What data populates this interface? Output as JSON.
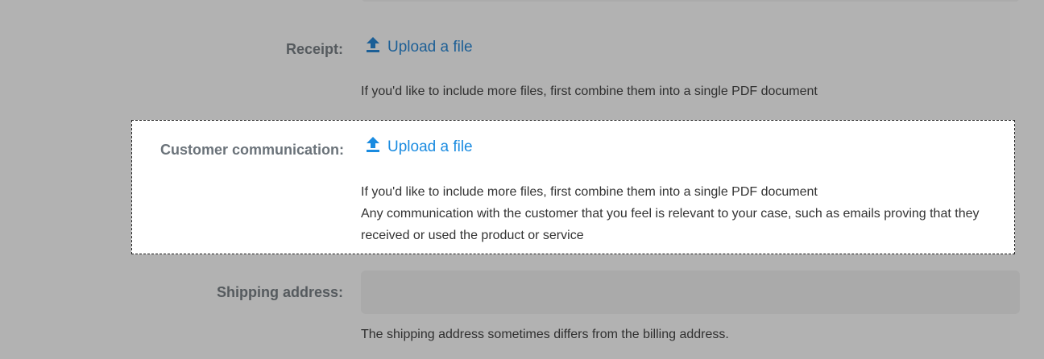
{
  "receipt": {
    "label": "Receipt:",
    "upload_label": "Upload a file",
    "upload_icon": "upload-icon",
    "help_text": "If you'd like to include more files, first combine them into a single PDF document"
  },
  "customer_communication": {
    "label": "Customer communication:",
    "upload_label": "Upload a file",
    "upload_icon": "upload-icon",
    "help_text_1": "If you'd like to include more files, first combine them into a single PDF document",
    "help_text_2": "Any communication with the customer that you feel is relevant to your case, such as emails proving that they",
    "help_text_3": "received or used the product or service"
  },
  "shipping_address": {
    "label": "Shipping address:",
    "value": "",
    "help_text": "The shipping address sometimes differs from the billing address."
  },
  "colors": {
    "overlay_background": "#b2b2b2",
    "highlight_background": "#ffffff",
    "link_active": "#1a8be0",
    "link_dimmed": "#1c5f96"
  }
}
